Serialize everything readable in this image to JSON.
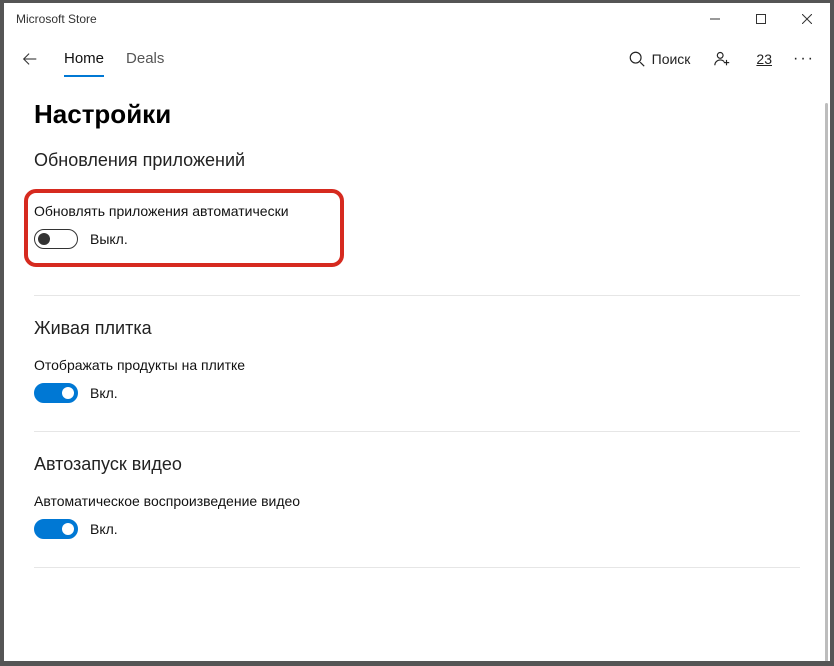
{
  "window": {
    "title": "Microsoft Store"
  },
  "nav": {
    "tabs": [
      {
        "label": "Home",
        "active": true
      },
      {
        "label": "Deals",
        "active": false
      }
    ],
    "search_label": "Поиск",
    "downloads_count": "23"
  },
  "page": {
    "title": "Настройки"
  },
  "sections": {
    "updates": {
      "title": "Обновления приложений",
      "setting_label": "Обновлять приложения автоматически",
      "toggle_on": false,
      "state_label": "Выкл."
    },
    "live_tile": {
      "title": "Живая плитка",
      "setting_label": "Отображать продукты на плитке",
      "toggle_on": true,
      "state_label": "Вкл."
    },
    "autoplay": {
      "title": "Автозапуск видео",
      "setting_label": "Автоматическое воспроизведение видео",
      "toggle_on": true,
      "state_label": "Вкл."
    },
    "cutoff": {
      "title": ""
    }
  }
}
